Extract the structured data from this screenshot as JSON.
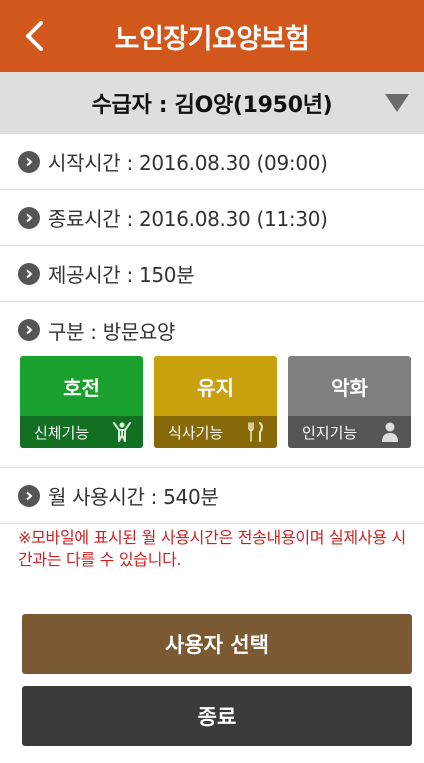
{
  "header": {
    "title": "노인장기요양보험",
    "back_icon": "chevron-left-icon"
  },
  "recipient": {
    "label": "수급자 : 김O양(1950년)",
    "dropdown_icon": "triangle-down-icon"
  },
  "info_rows": {
    "start": "시작시간 : 2016.08.30 (09:00)",
    "end": "종료시간 : 2016.08.30 (11:30)",
    "provided": "제공시간 : 150분",
    "category": "구분 : 방문요양"
  },
  "functions": [
    {
      "status": "호전",
      "label": "신체기능",
      "icon": "person-arms-up-icon",
      "color": "#1aa12d"
    },
    {
      "status": "유지",
      "label": "식사기능",
      "icon": "fork-knife-icon",
      "color": "#c9a00e"
    },
    {
      "status": "악화",
      "label": "인지기능",
      "icon": "person-icon",
      "color": "#808080"
    }
  ],
  "monthly_usage": "월 사용시간 : 540분",
  "notice": "※모바일에 표시된 월 사용시간은 전송내용이며 실제사용 시간과는 다를 수 있습니다.",
  "buttons": {
    "select_user": "사용자 선택",
    "exit": "종료"
  }
}
